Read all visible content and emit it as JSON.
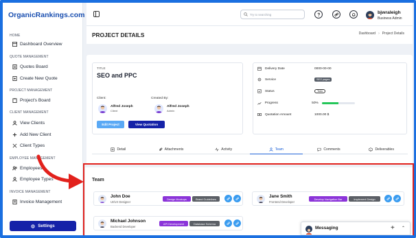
{
  "brand": {
    "logo_text": "OrganicRankings.com"
  },
  "sidebar": {
    "sections": {
      "home": "HOME",
      "quote": "QUOTE MANAGEMENT",
      "project": "PROJECT MANAGEMENT",
      "client": "CLIENT MANAGEMENT",
      "employee": "EMPLOYEE MANAGEMENT",
      "invoice": "INVOICE MANAGEMENT"
    },
    "items": {
      "dashboard": "Dashboard Overview",
      "quotes_board": "Quotes Board",
      "create_quote": "Create New Quote",
      "projects_board": "Project's Board",
      "view_clients": "View Clients",
      "add_client": "Add New Client",
      "client_types": "Client Types",
      "employees": "Employees",
      "employee_types": "Employee Types",
      "invoice_mgmt": "Invoice Management"
    },
    "settings_label": "Settings"
  },
  "topbar": {
    "search_placeholder": "Try to searching",
    "user_name": "bjwraleigh",
    "user_role": "Business Admin"
  },
  "page": {
    "title": "PROJECT DETAILS",
    "breadcrumb": [
      "Dashboard",
      "Project Details"
    ]
  },
  "project": {
    "title_label": "TITLE",
    "title": "SEO and PPC",
    "client_label": "Client:",
    "created_by_label": "Created By:",
    "client": {
      "name": "Alfred Joseph",
      "role": "Client"
    },
    "creator": {
      "name": "Alfred Joseph",
      "role": "Admin"
    },
    "edit_button": "Edit Project",
    "view_quotation_button": "View Quotation"
  },
  "details": {
    "delivery_label": "Delivery Date",
    "delivery_value": "0000-00-00",
    "service_label": "Service",
    "service_value": "SEO pages",
    "status_label": "Status",
    "status_value": "Todo",
    "progress_label": "Progress",
    "progress_value": "50%",
    "progress_fraction": 0.5,
    "amount_label": "Quotation Amount",
    "amount_value": "1000.00 $"
  },
  "tabs": [
    "Detail",
    "Attachments",
    "Activity",
    "Team",
    "Comments",
    "Deliverables"
  ],
  "team": {
    "title": "Team",
    "members": [
      {
        "name": "John Doe",
        "role": "UI/UX Designer",
        "skills": [
          "Design Mockups",
          "Brand Guidelines"
        ]
      },
      {
        "name": "Jane Smith",
        "role": "Frontend Developer",
        "skills": [
          "Develop Navigation Bar",
          "Implement Design"
        ]
      },
      {
        "name": "Michael Johnson",
        "role": "Backend Developer",
        "skills": [
          "API Development",
          "Database Schema"
        ]
      }
    ]
  },
  "messaging": {
    "label": "Messaging"
  },
  "colors": {
    "primary": "#1522a8",
    "accent": "#3a9cf0",
    "highlight": "#e2211c",
    "progress": "#24c659",
    "chip_purple": "#8b34d9"
  }
}
